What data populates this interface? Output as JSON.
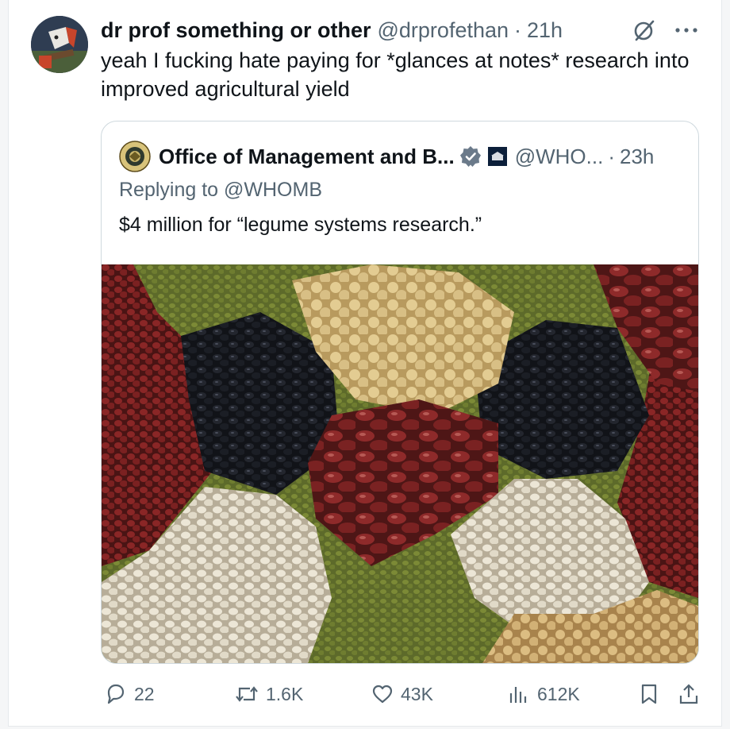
{
  "post": {
    "author": {
      "display_name": "dr prof something or other",
      "handle": "@drprofethan",
      "separator": "·",
      "time": "21h"
    },
    "icons": {
      "grok": "grok-slash-circle-icon",
      "more": "more-dots-icon"
    },
    "text": "yeah I fucking hate paying for *glances at notes* research into improved agricultural yield"
  },
  "quote": {
    "display_name": "Office of Management and B...",
    "handle": "@WHO...",
    "separator": "·",
    "time": "23h",
    "replying_to": "Replying to @WHOMB",
    "text": "$4 million for “legume systems research.”",
    "image_description_icon": "legumes-photo"
  },
  "actions": {
    "replies": "22",
    "reposts": "1.6K",
    "likes": "43K",
    "views": "612K"
  },
  "colors": {
    "text_primary": "#0f1419",
    "text_secondary": "#536471",
    "verified_gold": "#e8b829",
    "border": "#cfd9de"
  }
}
